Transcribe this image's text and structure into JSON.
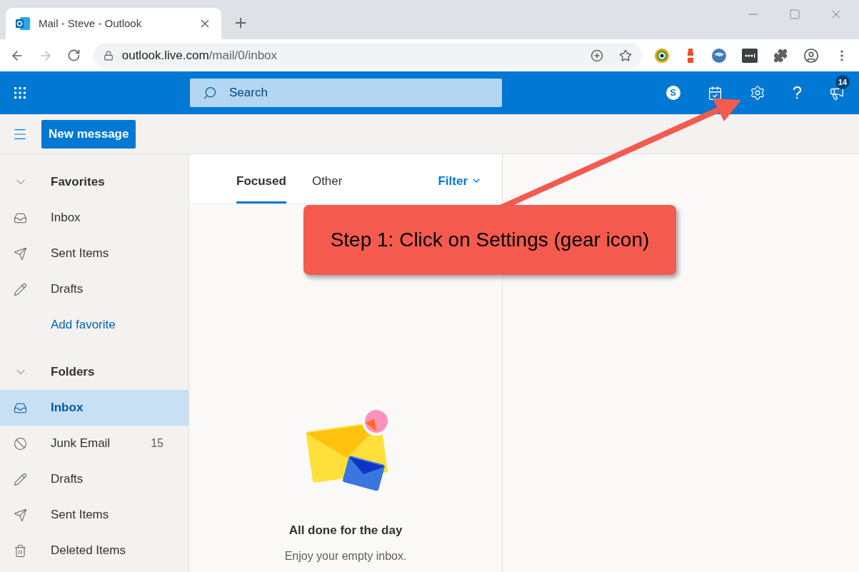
{
  "browser": {
    "tab_title": "Mail - Steve - Outlook",
    "url_host": "outlook.live.com",
    "url_path": "/mail/0/inbox"
  },
  "header": {
    "search_placeholder": "Search",
    "skype_letter": "S",
    "help_glyph": "?",
    "notification_count": "14"
  },
  "command_bar": {
    "new_message": "New message"
  },
  "sidebar": [
    {
      "title": "Favorites",
      "expanded": true,
      "items": [
        {
          "kind": "inbox",
          "label": "Inbox",
          "selected": false
        },
        {
          "kind": "sent",
          "label": "Sent Items",
          "selected": false
        },
        {
          "kind": "drafts",
          "label": "Drafts",
          "selected": false
        }
      ],
      "add_link": "Add favorite"
    },
    {
      "title": "Folders",
      "expanded": true,
      "items": [
        {
          "kind": "inbox",
          "label": "Inbox",
          "selected": true
        },
        {
          "kind": "junk",
          "label": "Junk Email",
          "selected": false,
          "count": "15"
        },
        {
          "kind": "drafts",
          "label": "Drafts",
          "selected": false
        },
        {
          "kind": "sent",
          "label": "Sent Items",
          "selected": false
        },
        {
          "kind": "deleted",
          "label": "Deleted Items",
          "selected": false
        }
      ]
    }
  ],
  "tabs": [
    {
      "label": "Focused",
      "selected": true
    },
    {
      "label": "Other",
      "selected": false
    }
  ],
  "filter": "Filter",
  "empty_state": {
    "title": "All done for the day",
    "subtitle": "Enjoy your empty inbox."
  },
  "callout": {
    "text": "Step 1: Click on Settings (gear icon)"
  }
}
